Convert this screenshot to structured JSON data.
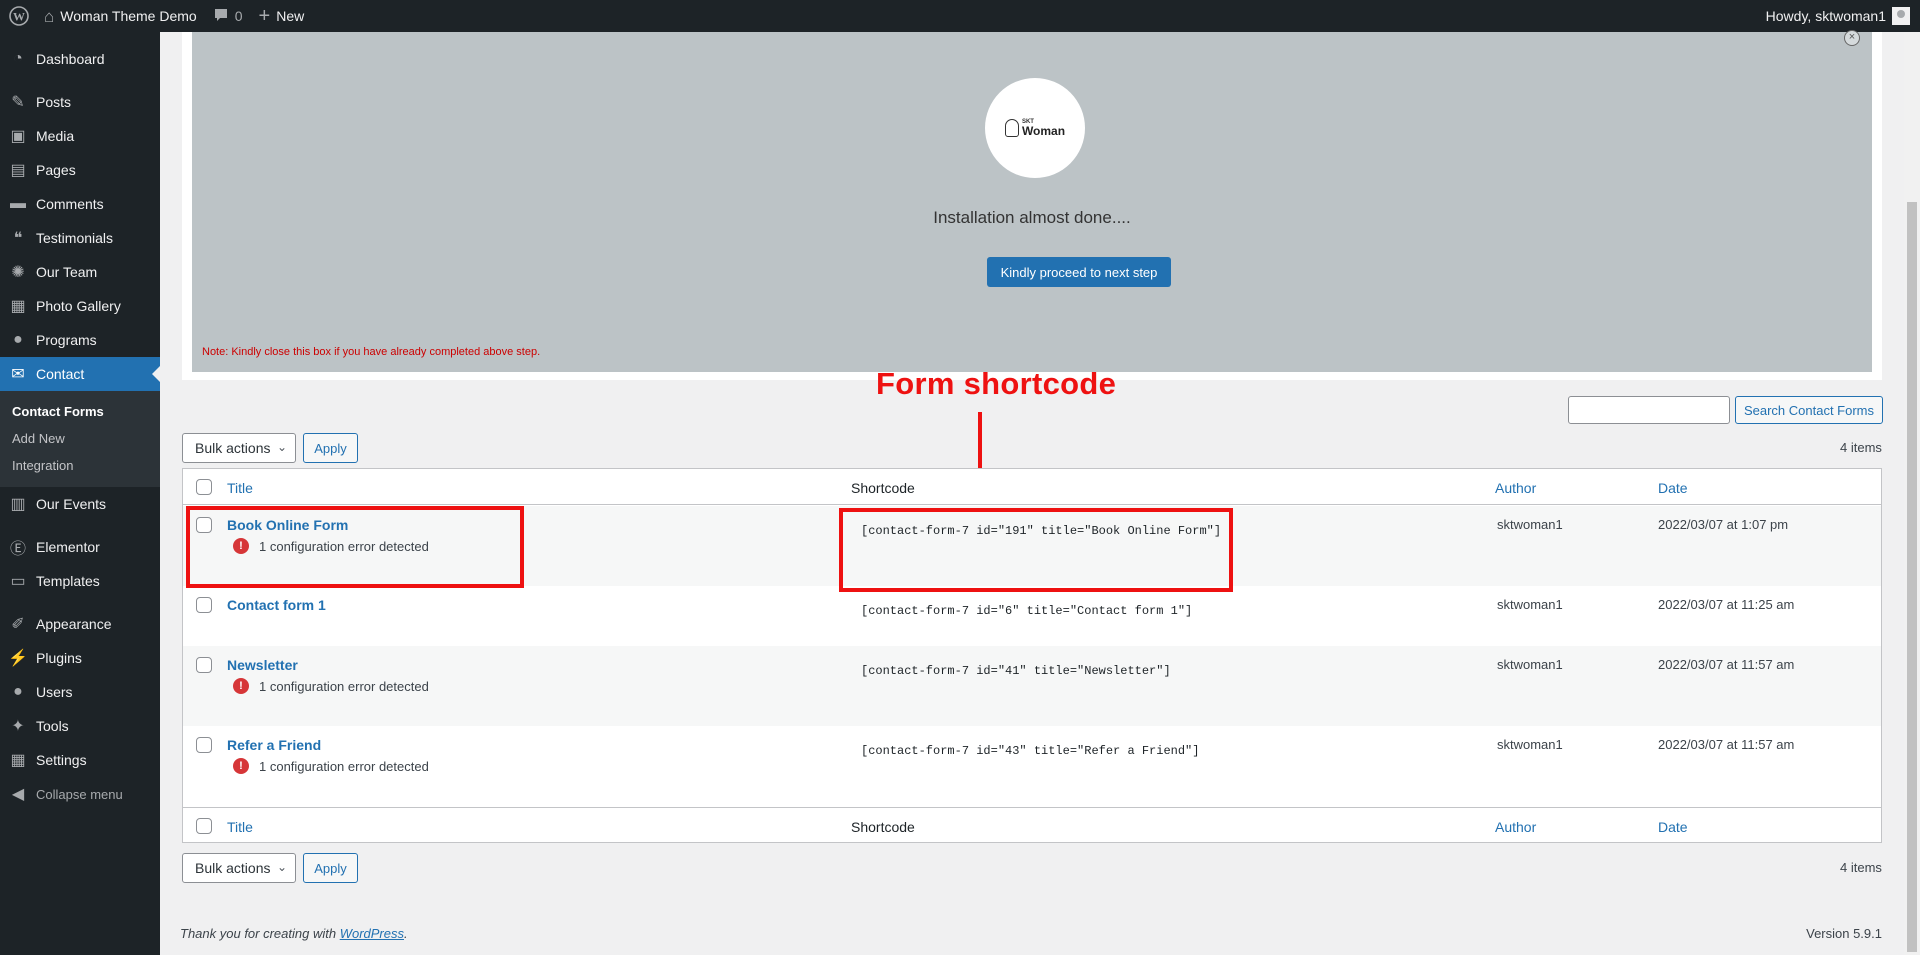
{
  "adminbar": {
    "site_name": "Woman Theme Demo",
    "comments_count": "0",
    "new_label": "New",
    "greeting": "Howdy, sktwoman1"
  },
  "sidebar": {
    "items": [
      {
        "label": "Dashboard",
        "icon": "dashboard-icon"
      },
      {
        "label": "Posts",
        "icon": "pin-icon"
      },
      {
        "label": "Media",
        "icon": "media-icon"
      },
      {
        "label": "Pages",
        "icon": "pages-icon"
      },
      {
        "label": "Comments",
        "icon": "comment-icon"
      },
      {
        "label": "Testimonials",
        "icon": "quote-icon"
      },
      {
        "label": "Our Team",
        "icon": "team-icon"
      },
      {
        "label": "Photo Gallery",
        "icon": "gallery-icon"
      },
      {
        "label": "Programs",
        "icon": "lightbulb-icon"
      },
      {
        "label": "Contact",
        "icon": "mail-icon"
      },
      {
        "label": "Our Events",
        "icon": "calendar-icon"
      },
      {
        "label": "Elementor",
        "icon": "elementor-icon"
      },
      {
        "label": "Templates",
        "icon": "folder-icon"
      },
      {
        "label": "Appearance",
        "icon": "brush-icon"
      },
      {
        "label": "Plugins",
        "icon": "plugin-icon"
      },
      {
        "label": "Users",
        "icon": "user-icon"
      },
      {
        "label": "Tools",
        "icon": "wrench-icon"
      },
      {
        "label": "Settings",
        "icon": "settings-icon"
      },
      {
        "label": "Collapse menu",
        "icon": "collapse-icon"
      }
    ],
    "submenu": [
      "Contact Forms",
      "Add New",
      "Integration"
    ]
  },
  "notice": {
    "logo_small": "SKT",
    "logo_big": "Woman",
    "installation_text": "Installation almost done....",
    "proceed_button": "Kindly proceed to next step",
    "note": "Note: Kindly close this box if you have already completed above step."
  },
  "annotation": {
    "label": "Form shortcode"
  },
  "toolbar": {
    "search_button": "Search Contact Forms",
    "items_count": "4 items",
    "bulk_actions": "Bulk actions",
    "apply": "Apply"
  },
  "table": {
    "headers": {
      "title": "Title",
      "shortcode": "Shortcode",
      "author": "Author",
      "date": "Date"
    },
    "error_text": "1 configuration error detected",
    "rows": [
      {
        "title": "Book Online Form",
        "error": true,
        "shortcode": "[contact-form-7 id=\"191\" title=\"Book Online Form\"]",
        "author": "sktwoman1",
        "date": "2022/03/07 at 1:07 pm"
      },
      {
        "title": "Contact form 1",
        "error": false,
        "shortcode": "[contact-form-7 id=\"6\" title=\"Contact form 1\"]",
        "author": "sktwoman1",
        "date": "2022/03/07 at 11:25 am"
      },
      {
        "title": "Newsletter",
        "error": true,
        "shortcode": "[contact-form-7 id=\"41\" title=\"Newsletter\"]",
        "author": "sktwoman1",
        "date": "2022/03/07 at 11:57 am"
      },
      {
        "title": "Refer a Friend",
        "error": true,
        "shortcode": "[contact-form-7 id=\"43\" title=\"Refer a Friend\"]",
        "author": "sktwoman1",
        "date": "2022/03/07 at 11:57 am"
      }
    ]
  },
  "footer": {
    "thanks_prefix": "Thank you for creating with ",
    "wordpress_link": "WordPress",
    "thanks_suffix": ".",
    "version": "Version 5.9.1"
  }
}
